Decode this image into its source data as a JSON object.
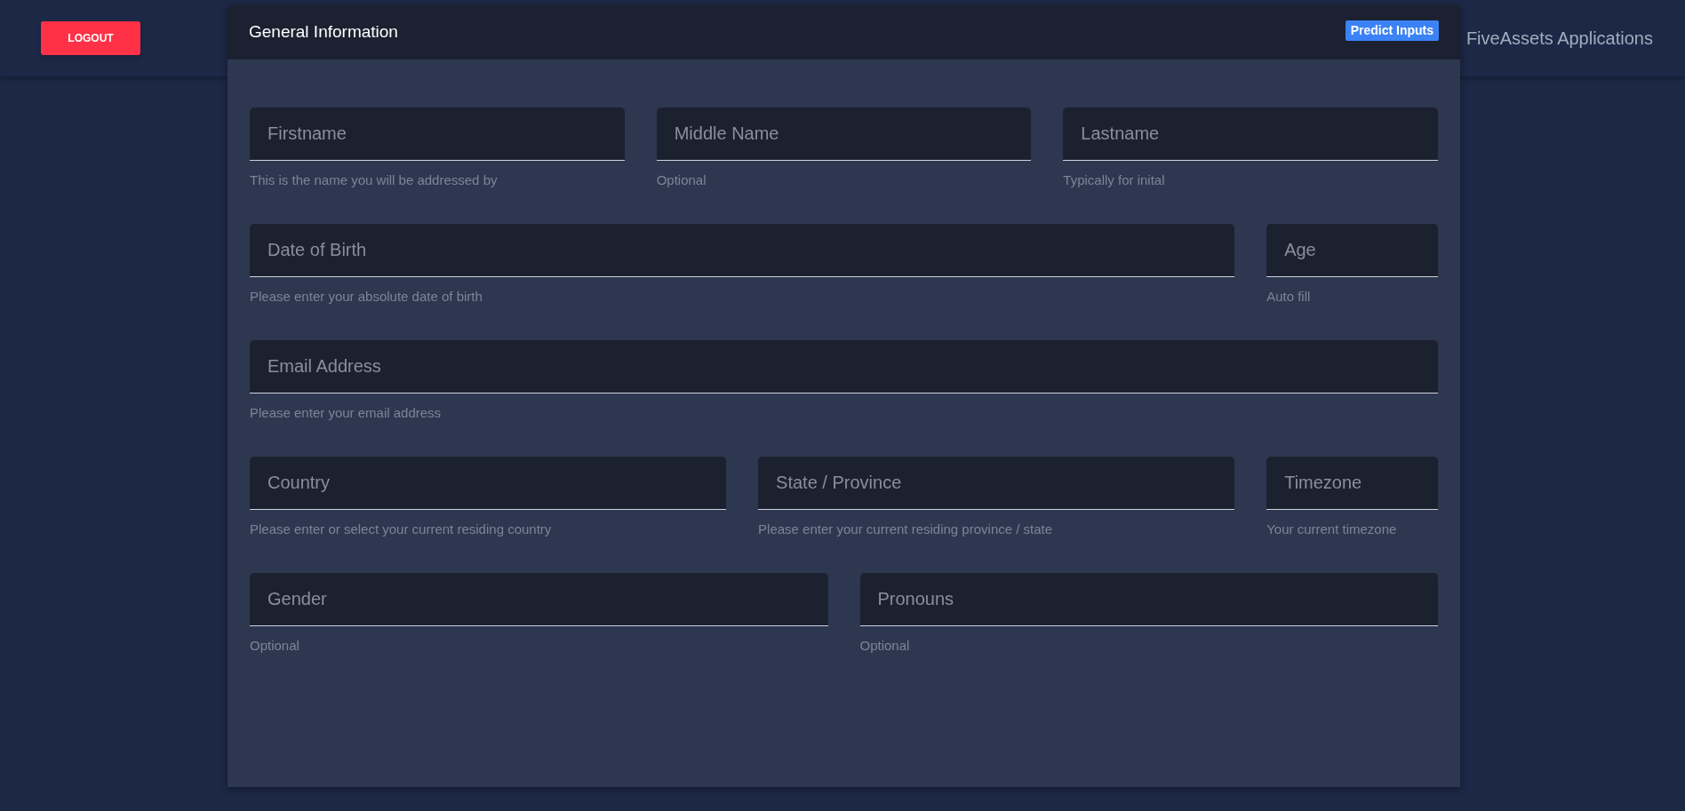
{
  "top_bar": {
    "logout_button": "LOGOUT",
    "app_title": "FiveAssets Applications"
  },
  "card": {
    "title": "General Information",
    "predict_button": "Predict Inputs",
    "rows": [
      [
        {
          "placeholder": "Firstname",
          "helper": "This is the name you will be addressed by"
        },
        {
          "placeholder": "Middle Name",
          "helper": "Optional"
        },
        {
          "placeholder": "Lastname",
          "helper": "Typically for inital"
        }
      ],
      [
        {
          "placeholder": "Date of Birth",
          "helper": "Please enter your absolute date of birth"
        },
        {
          "placeholder": "Age",
          "helper": "Auto fill"
        }
      ],
      [
        {
          "placeholder": "Email Address",
          "helper": "Please enter your email address"
        }
      ],
      [
        {
          "placeholder": "Country",
          "helper": "Please enter or select your current residing country"
        },
        {
          "placeholder": "State / Province",
          "helper": "Please enter your current residing province / state"
        },
        {
          "placeholder": "Timezone",
          "helper": "Your current timezone"
        }
      ],
      [
        {
          "placeholder": "Gender",
          "helper": "Optional"
        },
        {
          "placeholder": "Pronouns",
          "helper": "Optional"
        }
      ]
    ]
  }
}
